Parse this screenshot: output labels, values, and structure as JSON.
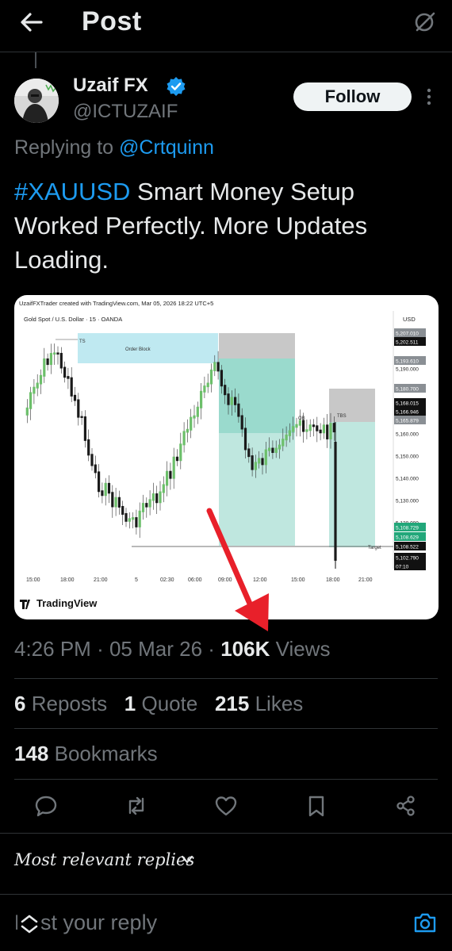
{
  "header": {
    "title": "Post"
  },
  "author": {
    "name": "Uzaif FX",
    "handle": "@ICTUZAIF",
    "follow_label": "Follow"
  },
  "reply_context": {
    "prefix": "Replying to",
    "mention": "@Crtquinn"
  },
  "tweet": {
    "hashtag": "#XAUUSD",
    "text": " Smart Money Setup Worked Perfectly. More Updates Loading."
  },
  "media": {
    "header": "UzaifFXTrader created with TradingView.com, Mar 05, 2026 18:22 UTC+5",
    "symbol": "Gold Spot / U.S. Dollar · 15 · OANDA",
    "currency": "USD",
    "labels": {
      "ts": "TS",
      "order_block": "Order Block",
      "ob": "OB",
      "tbs": "TBS",
      "target": "Target"
    },
    "price_labels": [
      "5,207.010",
      "5,202.511",
      "5,193.610",
      "5,190.000",
      "5,180.700",
      "5,168.015",
      "5,166.946",
      "5,165.879",
      "5,160.000",
      "5,150.000",
      "5,140.000",
      "5,130.000",
      "5,120.000",
      "5,108.729",
      "5,108.629",
      "5,108.522",
      "5,102.790",
      "07:10"
    ],
    "time_labels": [
      "15:00",
      "18:00",
      "21:00",
      "5",
      "02:30",
      "06:00",
      "09:00",
      "12:00",
      "15:00",
      "18:00",
      "21:00"
    ],
    "logo": "TradingView"
  },
  "meta": {
    "time": "4:26 PM",
    "date": "05 Mar 26",
    "views": "106K",
    "views_label": "Views",
    "sep": "·"
  },
  "stats": {
    "reposts": "6",
    "reposts_label": "Reposts",
    "quotes": "1",
    "quotes_label": "Quote",
    "likes": "215",
    "likes_label": "Likes",
    "bookmarks": "148",
    "bookmarks_label": "Bookmarks"
  },
  "sort": {
    "label": "Most relevant replies"
  },
  "reply": {
    "placeholder": "Post your reply"
  },
  "colors": {
    "accent": "#1d9bf0",
    "arrow": "#e8202a",
    "up_candle": "#6cbf6a",
    "down_candle": "#1a1a1a"
  }
}
